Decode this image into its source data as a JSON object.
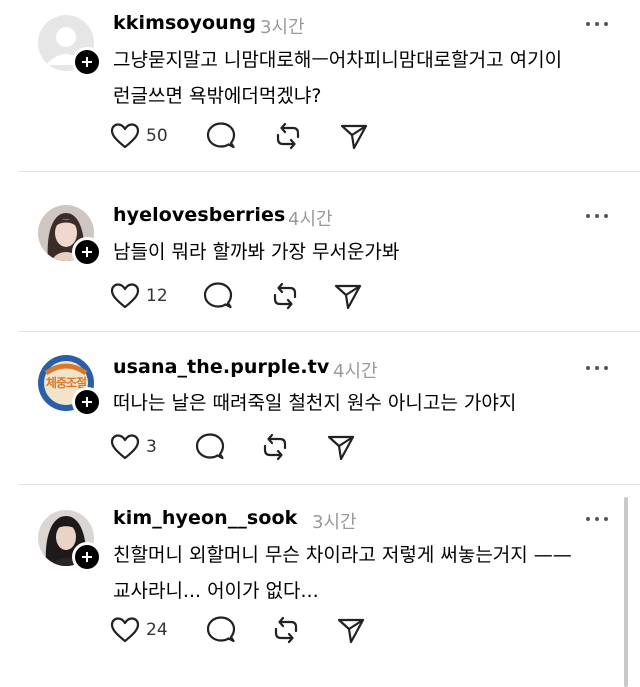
{
  "posts": [
    {
      "username": "kkimsoyoung",
      "time": "3시간",
      "text_lines": [
        "그냥묻지말고 니맘대로해ㅡ어차피니맘대로할거고 여기이",
        "런글쓰면 욕밖에더먹겠냐?"
      ],
      "likes": "50",
      "avatar": "default-avatar"
    },
    {
      "username": "hyelovesberries",
      "time": "4시간",
      "text_lines": [
        "남들이 뭐라 할까봐 가장 무서운가봐"
      ],
      "likes": "12",
      "avatar": "photo-avatar"
    },
    {
      "username": "usana_the.purple.tv",
      "time": "4시간",
      "text_lines": [
        "떠나는 날은 때려죽일 철천지 원수 아니고는 가야지"
      ],
      "likes": "3",
      "avatar": "logo-avatar",
      "avatar_logo_text": "체중조절"
    },
    {
      "username": "kim_hyeon__sook",
      "time": "3시간",
      "text_lines": [
        "친할머니 외할머니 무슨 차이라고 저렇게 써놓는거지 ——",
        "교사라니... 어이가 없다..."
      ],
      "likes": "24",
      "avatar": "photo-avatar"
    }
  ],
  "icons": {
    "like": "heart-icon",
    "reply": "comment-bubble-icon",
    "repost": "repost-icon",
    "share": "send-icon",
    "more": "more-dots-icon",
    "follow": "plus-icon"
  }
}
